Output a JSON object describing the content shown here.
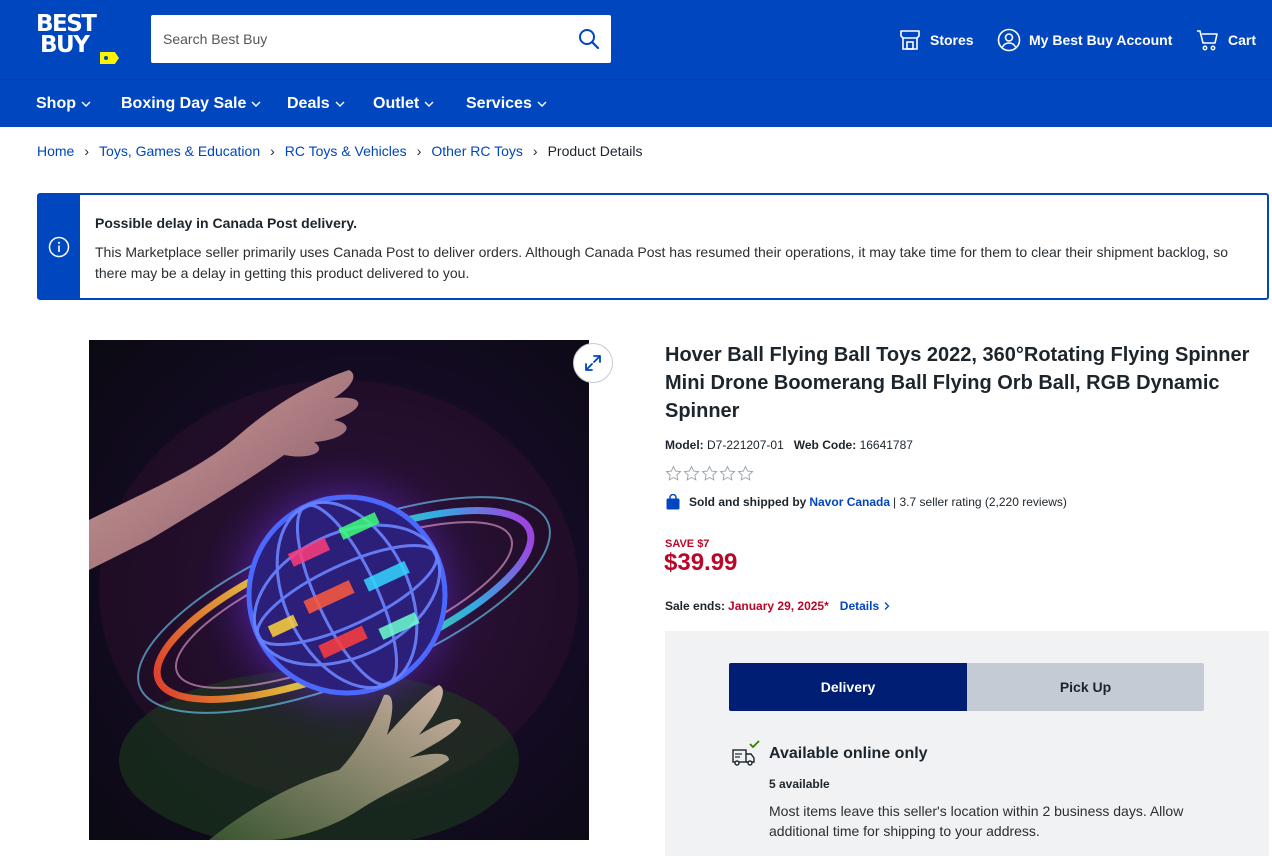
{
  "header": {
    "logo_line1": "BEST",
    "logo_line2": "BUY",
    "search_placeholder": "Search Best Buy",
    "stores_label": "Stores",
    "account_label": "My Best Buy Account",
    "cart_label": "Cart"
  },
  "nav": {
    "items": [
      {
        "label": "Shop"
      },
      {
        "label": "Boxing Day Sale"
      },
      {
        "label": "Deals"
      },
      {
        "label": "Outlet"
      },
      {
        "label": "Services"
      }
    ]
  },
  "breadcrumb": {
    "items": [
      "Home",
      "Toys, Games & Education",
      "RC Toys & Vehicles",
      "Other RC Toys"
    ],
    "current": "Product Details"
  },
  "alert": {
    "title": "Possible delay in Canada Post delivery.",
    "body": "This Marketplace seller primarily uses Canada Post to deliver orders. Although Canada Post has resumed their operations, it may take time for them to clear their shipment backlog, so there may be a delay in getting this product delivered to you."
  },
  "product": {
    "title": "Hover Ball Flying Ball Toys 2022, 360°Rotating Flying Spinner Mini Drone Boomerang Ball Flying Orb Ball, RGB Dynamic Spinner",
    "model_label": "Model:",
    "model": "D7-221207-01",
    "webcode_label": "Web Code:",
    "webcode": "16641787",
    "rating_stars": 0,
    "seller_prefix": "Sold and shipped by",
    "seller_name": "Navor Canada",
    "seller_rating": "| 3.7 seller rating (2,220 reviews)",
    "save_text": "SAVE $7",
    "price": "$39.99",
    "sale_ends_label": "Sale ends:",
    "sale_ends_date": "January 29, 2025*",
    "details_link": "Details"
  },
  "fulfillment": {
    "tab_delivery": "Delivery",
    "tab_pickup": "Pick Up",
    "availability_title": "Available online only",
    "available_count": "5 available",
    "note": "Most items leave this seller's location within 2 business days. Allow additional time for shipping to your address."
  },
  "colors": {
    "brand_blue": "#0046be",
    "dark_blue": "#001e73",
    "sale_red": "#bb0628",
    "logo_yellow": "#fff200"
  }
}
